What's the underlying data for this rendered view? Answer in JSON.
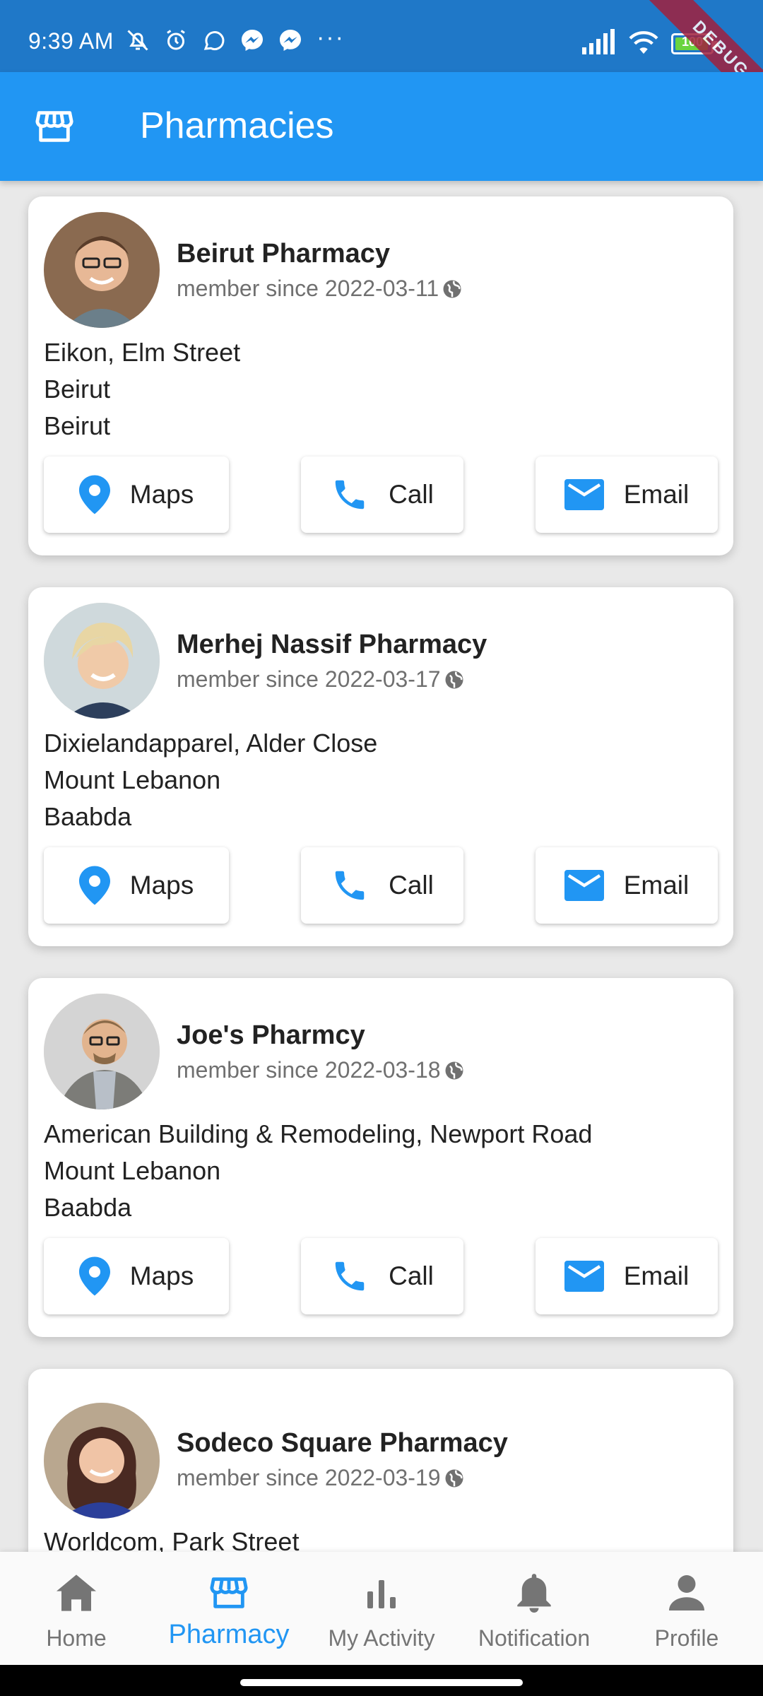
{
  "status_bar": {
    "time": "9:39 AM",
    "more": "···",
    "battery": "100",
    "debug_banner": "DEBUG"
  },
  "app_bar": {
    "icon": "storefront-icon",
    "title": "Pharmacies"
  },
  "buttons": {
    "maps": "Maps",
    "call": "Call",
    "email": "Email"
  },
  "pharmacies": [
    {
      "name": "Beirut Pharmacy",
      "since": "member since 2022-03-11",
      "address": [
        "Eikon, Elm Street",
        "Beirut",
        "Beirut"
      ]
    },
    {
      "name": "Merhej Nassif Pharmacy",
      "since": "member since 2022-03-17",
      "address": [
        "Dixielandapparel, Alder Close",
        "Mount Lebanon",
        "Baabda"
      ]
    },
    {
      "name": "Joe's Pharmcy",
      "since": "member since 2022-03-18",
      "address": [
        "American Building & Remodeling,  Newport Road",
        "Mount Lebanon",
        "Baabda"
      ]
    },
    {
      "name": "Sodeco Square Pharmacy",
      "since": "member since 2022-03-19",
      "address": [
        "Worldcom, Park Street"
      ]
    }
  ],
  "bottom_nav": {
    "home": "Home",
    "pharmacy": "Pharmacy",
    "activity": "My Activity",
    "notification": "Notification",
    "profile": "Profile",
    "active": "pharmacy",
    "active_color": "#2196f3"
  },
  "colors": {
    "app_bar": "#2196f3",
    "status_bar": "#1f78c8",
    "accent": "#2196f3"
  }
}
